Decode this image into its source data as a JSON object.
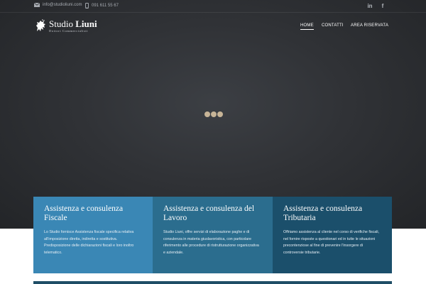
{
  "topbar": {
    "email": "info@studioliuni.com",
    "phone": "091 611 55 67",
    "email_icon": "envelope-icon",
    "phone_icon": "mobile-phone-icon",
    "social": [
      {
        "name": "linkedin",
        "label": "in"
      },
      {
        "name": "facebook",
        "label": "f"
      }
    ]
  },
  "brand": {
    "name_regular": "Studio ",
    "name_bold": "Liuni",
    "subtitle": "Dottori Commercialisti",
    "logo_icon": "lion-crest-icon"
  },
  "nav": {
    "items": [
      {
        "label": "HOME",
        "active": true
      },
      {
        "label": "CONTATTI",
        "active": false
      },
      {
        "label": "AREA RISERVATA",
        "active": false
      }
    ]
  },
  "loader": {
    "dots": 3,
    "color": "#c7b497"
  },
  "services": [
    {
      "title": "Assistenza e consulenza Fiscale",
      "text": "Lo Studio fornisce Assistenza fiscale specifica relativa all'imposizione diretta, indiretta e sostitutiva. Predisposizione delle dichiarazioni fiscali e loro inoltro telematico.",
      "color": "#3a87b5"
    },
    {
      "title": "Assistenza e consulenza del Lavoro",
      "text": "Studio Liuni, offre servizi di elaborazione paghe e di consulenza in materia giuslavoristica, con particolare riferimento alle procedure di ristrutturazione organizzativa e aziendale.",
      "color": "#2b6d8e"
    },
    {
      "title": "Assistenza e consulenza Tributaria",
      "text": "Offriamo assistenza al cliente nel corso di verifiche fiscali, nel fornire risposte a questionari ed in tutte le situazioni precontenziose al fine di prevenire l'insorgere di controversie tributarie.",
      "color": "#1b4f6b"
    }
  ]
}
